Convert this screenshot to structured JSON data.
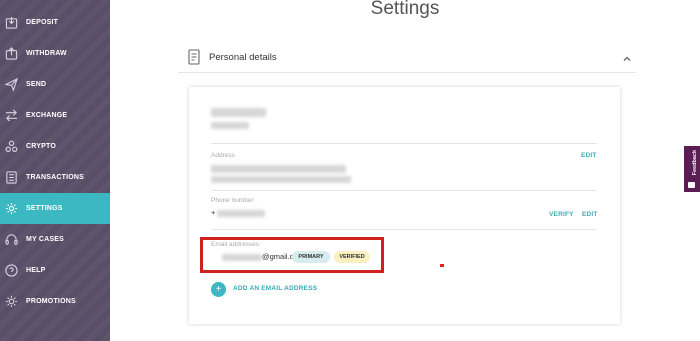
{
  "sidebar": {
    "items": [
      {
        "label": "DEPOSIT",
        "icon": "deposit-icon"
      },
      {
        "label": "WITHDRAW",
        "icon": "withdraw-icon"
      },
      {
        "label": "SEND",
        "icon": "send-icon"
      },
      {
        "label": "EXCHANGE",
        "icon": "exchange-icon"
      },
      {
        "label": "CRYPTO",
        "icon": "crypto-icon"
      },
      {
        "label": "TRANSACTIONS",
        "icon": "transactions-icon"
      },
      {
        "label": "SETTINGS",
        "icon": "settings-icon",
        "active": true
      },
      {
        "label": "MY CASES",
        "icon": "headset-icon"
      },
      {
        "label": "HELP",
        "icon": "help-icon"
      },
      {
        "label": "PROMOTIONS",
        "icon": "promotions-icon"
      }
    ],
    "active_color": "#3bb8c1",
    "background": "#5b5069"
  },
  "page": {
    "title": "Settings"
  },
  "personal_details": {
    "title": "Personal details",
    "address_label": "Address",
    "address_edit": "EDIT",
    "phone_label": "Phone number",
    "phone_prefix": "+",
    "phone_verify": "VERIFY",
    "phone_edit": "EDIT",
    "email_label": "Email addresses",
    "email_value": "@gmail.com",
    "badge_primary": "PRIMARY",
    "badge_verified": "VERIFIED",
    "add_email": "ADD AN EMAIL ADDRESS",
    "add_symbol": "+"
  },
  "feedback": {
    "label": "Feedback"
  },
  "colors": {
    "accent": "#3bb8c1",
    "highlight": "#d01f1f",
    "feedback": "#5a1d54"
  }
}
